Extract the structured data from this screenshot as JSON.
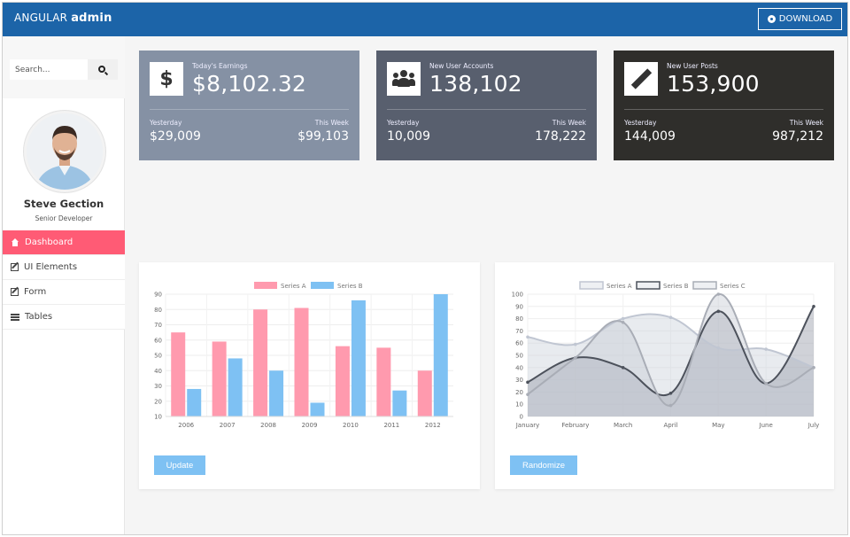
{
  "header": {
    "brand_light": "ANGULAR",
    "brand_bold": "admin",
    "download_label": "DOWNLOAD",
    "download_icon": "github-icon"
  },
  "sidebar": {
    "search": {
      "placeholder": "Search...",
      "value": ""
    },
    "user": {
      "name": "Steve Gection",
      "role": "Senior Developer"
    },
    "nav": [
      {
        "label": "Dashboard",
        "icon": "home-icon",
        "active": true
      },
      {
        "label": "UI Elements",
        "icon": "edit-icon",
        "active": false
      },
      {
        "label": "Form",
        "icon": "edit-icon",
        "active": false
      },
      {
        "label": "Tables",
        "icon": "bars-icon",
        "active": false
      }
    ],
    "active_color": "#ff5b75"
  },
  "cards": [
    {
      "icon": "dollar-icon",
      "icon_glyph": "$",
      "label": "Today's Earnings",
      "value": "$8,102.32",
      "left_label": "Yesterday",
      "left_value": "$29,009",
      "right_label": "This Week",
      "right_value": "$99,103",
      "color": "#8591a4"
    },
    {
      "icon": "users-icon",
      "label": "New User Accounts",
      "value": "138,102",
      "left_label": "Yesterday",
      "left_value": "10,009",
      "right_label": "This Week",
      "right_value": "178,222",
      "color": "#585f6e"
    },
    {
      "icon": "pencil-icon",
      "label": "New User Posts",
      "value": "153,900",
      "left_label": "Yesterday",
      "left_value": "144,009",
      "right_label": "This Week",
      "right_value": "987,212",
      "color": "#2f2e2b"
    }
  ],
  "panels": {
    "bar_button": "Update",
    "line_button": "Randomize"
  },
  "chart_data": [
    {
      "type": "bar",
      "categories": [
        "2006",
        "2007",
        "2008",
        "2009",
        "2010",
        "2011",
        "2012"
      ],
      "series": [
        {
          "name": "Series A",
          "values": [
            65,
            59,
            80,
            81,
            56,
            55,
            40
          ],
          "color": "#ff9aae"
        },
        {
          "name": "Series B",
          "values": [
            28,
            48,
            40,
            19,
            86,
            27,
            90
          ],
          "color": "#7ec1f3"
        }
      ],
      "ylim": [
        10,
        90
      ],
      "yticks": [
        10,
        20,
        30,
        40,
        50,
        60,
        70,
        80,
        90
      ],
      "legend": "top",
      "grid": true
    },
    {
      "type": "area",
      "categories": [
        "January",
        "February",
        "March",
        "April",
        "May",
        "June",
        "July"
      ],
      "series": [
        {
          "name": "Series A",
          "values": [
            65,
            59,
            80,
            81,
            56,
            55,
            40
          ],
          "stroke": "#c0c6d2",
          "fill": "rgba(205,210,220,0.45)"
        },
        {
          "name": "Series B",
          "values": [
            28,
            48,
            40,
            19,
            86,
            27,
            90
          ],
          "stroke": "#4d525c",
          "fill": "rgba(150,156,168,0.45)"
        },
        {
          "name": "Series C",
          "values": [
            18,
            48,
            77,
            9,
            100,
            27,
            40
          ],
          "stroke": "#a9adb6",
          "fill": "rgba(200,204,212,0.45)"
        }
      ],
      "ylim": [
        0,
        100
      ],
      "yticks": [
        0,
        10,
        20,
        30,
        40,
        50,
        60,
        70,
        80,
        90,
        100
      ],
      "legend": "top",
      "grid": true
    }
  ]
}
